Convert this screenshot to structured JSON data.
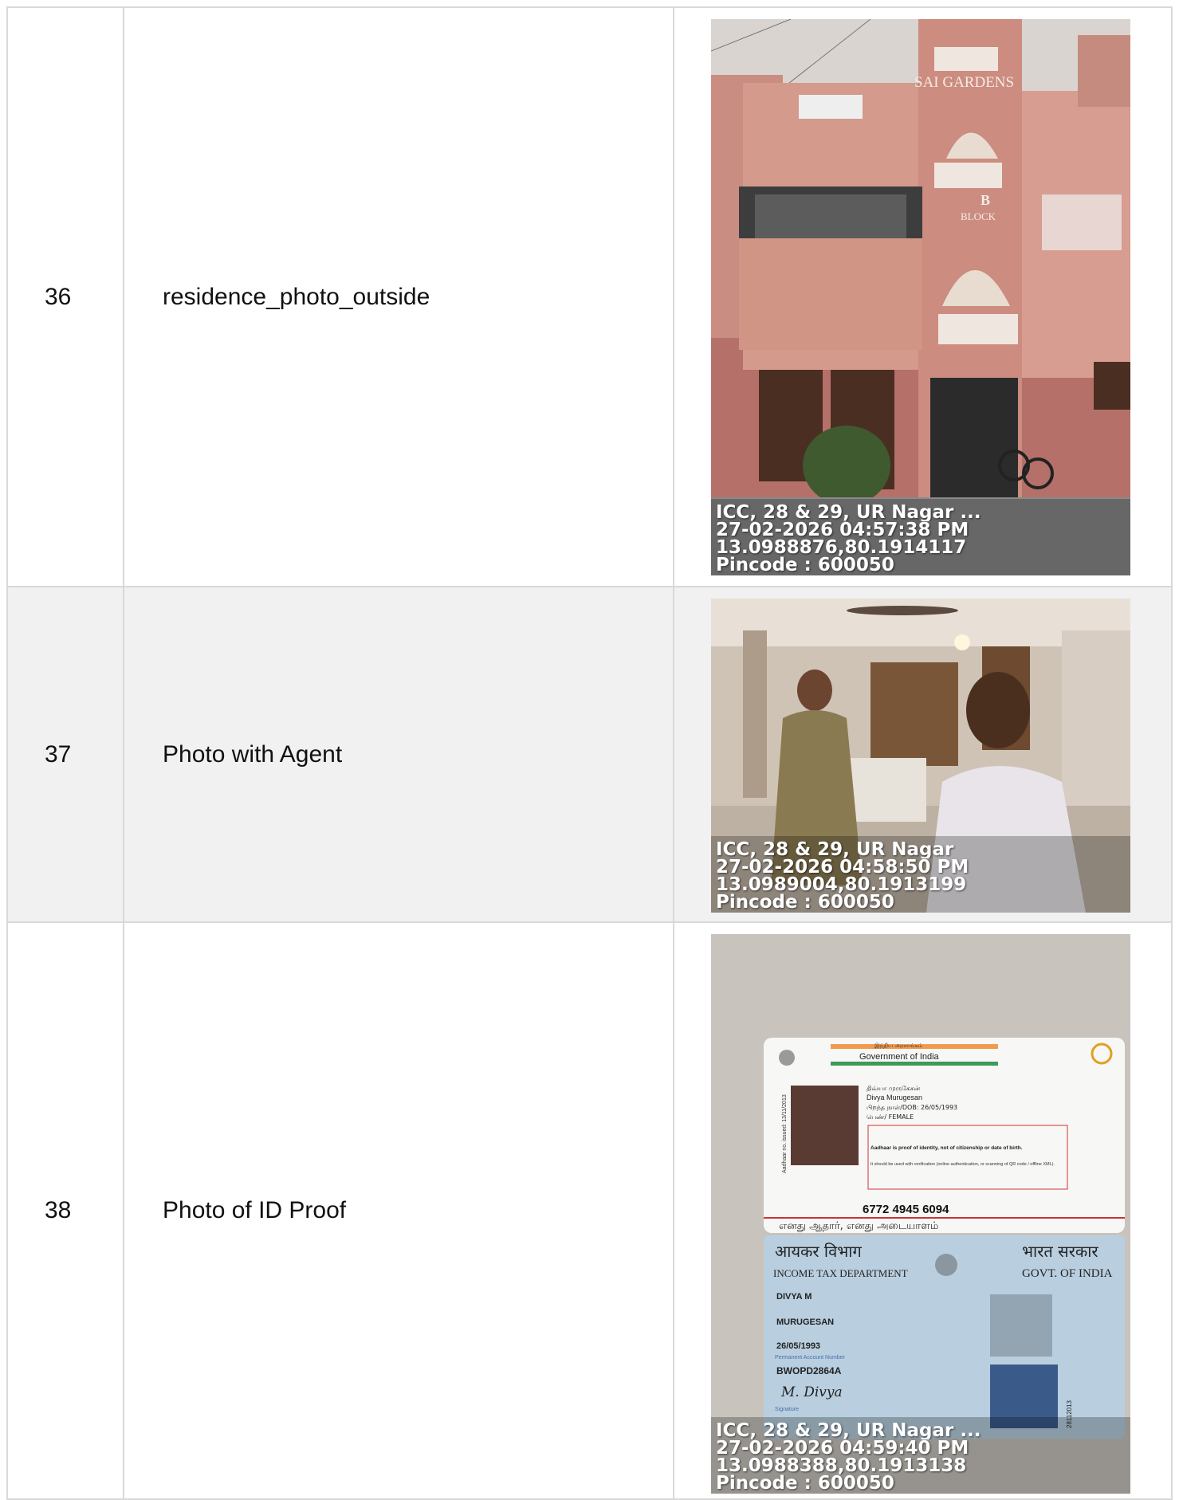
{
  "rows": [
    {
      "number": "36",
      "label": "residence_photo_outside",
      "photo": {
        "sign_top": "SAI GARDENS",
        "sign_block_letter": "B",
        "sign_block": "BLOCK",
        "overlay": [
          "ICC, 28 & 29, UR Nagar ...",
          "27-02-2026 04:57:38 PM",
          "13.0988876,80.1914117",
          "Pincode : 600050"
        ]
      }
    },
    {
      "number": "37",
      "label": "Photo with Agent",
      "photo": {
        "overlay": [
          "ICC, 28 & 29, UR Nagar",
          "27-02-2026 04:58:50 PM",
          "13.0989004,80.1913199",
          "Pincode : 600050"
        ]
      }
    },
    {
      "number": "38",
      "label": "Photo of ID Proof",
      "photo": {
        "aadhaar": {
          "header_tamil": "இந்திய அரசாங்கம்",
          "header": "Government of India",
          "name_tamil": "திவ்யா முருகேசன்",
          "name": "Divya Murugesan",
          "dob": "பிறந்த நாள்/DOB: 26/05/1993",
          "gender": "பெண்/ FEMALE",
          "side_text": "Aadhaar no. issued: 13/11/2013",
          "notice_bold": "Aadhaar is proof of identity, not of citizenship or date of birth.",
          "notice": "It should be used with verification (online authentication, or scanning of QR code / offline XML).",
          "number": "6772 4945 6094",
          "footer_tamil": "எனது ஆதார், எனது அடையாளம்"
        },
        "pan": {
          "dept_hindi": "आयकर विभाग",
          "govt_hindi": "भारत सरकार",
          "dept": "INCOME TAX DEPARTMENT",
          "govt": "GOVT. OF INDIA",
          "name": "DIVYA M",
          "father": "MURUGESAN",
          "dob": "26/05/1993",
          "pan_label": "Permanent Account Number",
          "pan_number": "BWOPD2864A",
          "signature": "M. Divya",
          "signature_label": "Signature",
          "side_date": "28112013"
        },
        "overlay": [
          "ICC, 28 & 29, UR Nagar ...",
          "27-02-2026 04:59:40 PM",
          "13.0988388,80.1913138",
          "Pincode : 600050"
        ]
      }
    }
  ]
}
